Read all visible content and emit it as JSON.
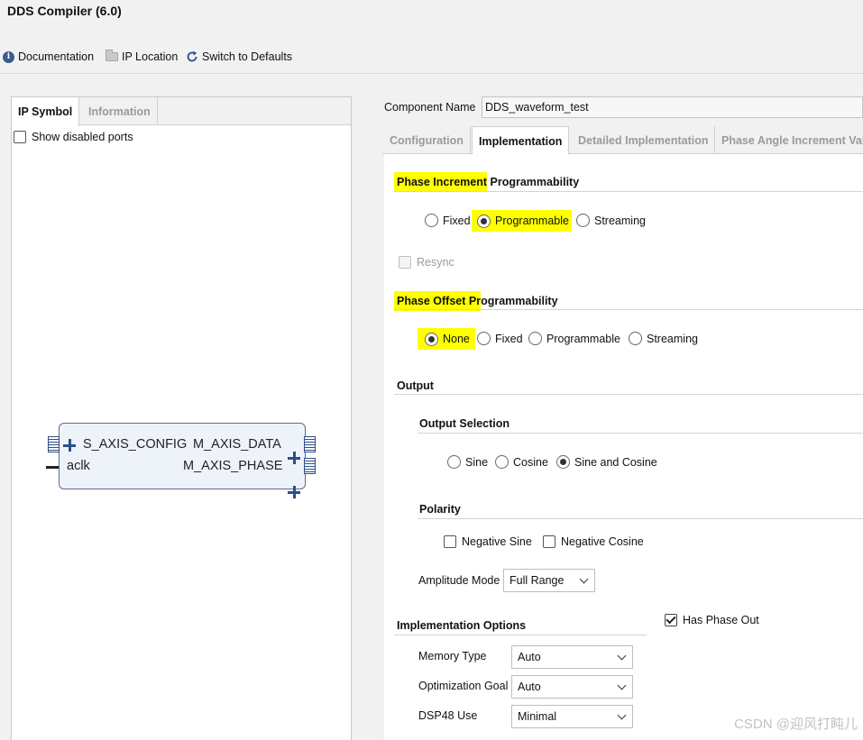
{
  "window": {
    "title": "DDS Compiler (6.0)"
  },
  "toolbar": {
    "documentation": "Documentation",
    "ip_location": "IP Location",
    "switch_defaults": "Switch to Defaults"
  },
  "left": {
    "tabs": [
      "IP Symbol",
      "Information"
    ],
    "show_disabled_ports": "Show disabled ports",
    "ports": {
      "s_axis_config": "S_AXIS_CONFIG",
      "aclk": "aclk",
      "m_axis_data": "M_AXIS_DATA",
      "m_axis_phase": "M_AXIS_PHASE"
    }
  },
  "component": {
    "label": "Component Name",
    "value": "DDS_waveform_test"
  },
  "right_tabs": [
    "Configuration",
    "Implementation",
    "Detailed Implementation",
    "Phase Angle Increment Valu"
  ],
  "phase_increment": {
    "title_hl": "Phase Increment",
    "title_rest": " Programmability",
    "options": [
      "Fixed",
      "Programmable",
      "Streaming"
    ],
    "selected": "Programmable",
    "resync": "Resync"
  },
  "phase_offset": {
    "title_hl": "Phase Offset Pr",
    "title_rest": "ogrammability",
    "options": [
      "None",
      "Fixed",
      "Programmable",
      "Streaming"
    ],
    "selected": "None"
  },
  "output": {
    "title": "Output",
    "selection_title": "Output Selection",
    "selection_options": [
      "Sine",
      "Cosine",
      "Sine and Cosine"
    ],
    "selection_selected": "Sine and Cosine",
    "polarity_title": "Polarity",
    "negative_sine": "Negative Sine",
    "negative_cosine": "Negative Cosine",
    "amplitude_label": "Amplitude Mode",
    "amplitude_value": "Full Range"
  },
  "implementation_options": {
    "title": "Implementation Options",
    "has_phase_out": "Has Phase Out",
    "memory_type_label": "Memory Type",
    "memory_type_value": "Auto",
    "optimization_goal_label": "Optimization Goal",
    "optimization_goal_value": "Auto",
    "dsp48_label": "DSP48 Use",
    "dsp48_value": "Minimal"
  },
  "watermark": "CSDN @迎风打盹儿",
  "colors": {
    "highlight": "#ffff00",
    "symbol_fill": "#eef3fa",
    "symbol_port": "#2c4f8a"
  }
}
